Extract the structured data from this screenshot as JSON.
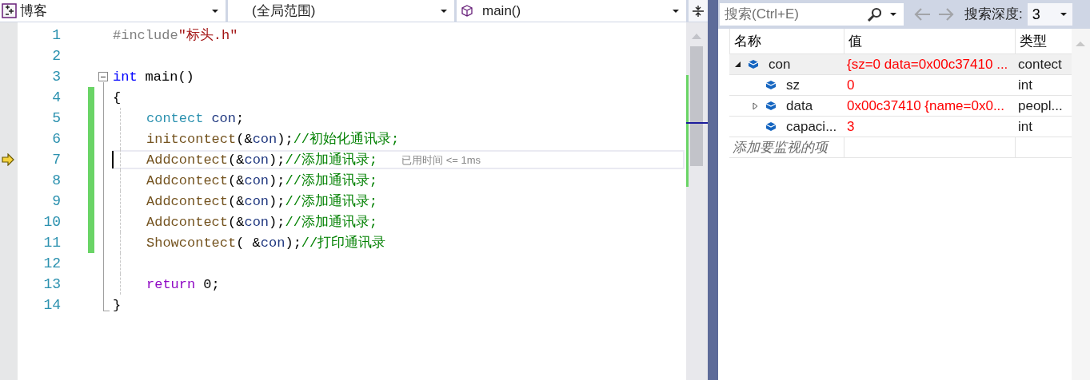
{
  "navbar": {
    "project": "博客",
    "scope": "(全局范围)",
    "member": "main()"
  },
  "editor": {
    "lines": [
      {
        "number": "1",
        "changed": false,
        "current": false,
        "fold": false,
        "indented": false,
        "tokens": [
          {
            "kind": "preproc",
            "text": "#include"
          },
          {
            "kind": "string",
            "text": "\"标头.h\""
          }
        ]
      },
      {
        "number": "2",
        "changed": false,
        "current": false,
        "fold": false,
        "indented": false
      },
      {
        "number": "3",
        "changed": false,
        "current": false,
        "fold": true,
        "indented": false,
        "tokens": [
          {
            "kind": "keyword",
            "text": "int"
          },
          {
            "kind": "plain",
            "text": "main()",
            "spaced": true
          }
        ]
      },
      {
        "number": "4",
        "changed": true,
        "current": false,
        "fold": false,
        "indented": false,
        "tokens": [
          {
            "kind": "plain",
            "text": "{"
          }
        ]
      },
      {
        "number": "5",
        "changed": true,
        "current": false,
        "fold": false,
        "indented": true,
        "tokens": [
          {
            "kind": "type",
            "text": "contect"
          },
          {
            "kind": "variable",
            "text": "con",
            "spaced": true
          },
          {
            "kind": "plain",
            "text": ";"
          }
        ]
      },
      {
        "number": "6",
        "changed": true,
        "current": false,
        "fold": false,
        "indented": true,
        "tokens": [
          {
            "kind": "function",
            "text": "initcontect"
          },
          {
            "kind": "plain",
            "text": "(&"
          },
          {
            "kind": "variable",
            "text": "con"
          },
          {
            "kind": "plain",
            "text": ");"
          },
          {
            "kind": "comment",
            "text": "//初始化通讯录;"
          }
        ]
      },
      {
        "number": "7",
        "changed": true,
        "current": true,
        "hint": "已用时间 <= 1ms",
        "fold": false,
        "indented": true,
        "tokens": [
          {
            "kind": "function",
            "text": "Addcontect"
          },
          {
            "kind": "plain",
            "text": "(&"
          },
          {
            "kind": "variable",
            "text": "con"
          },
          {
            "kind": "plain",
            "text": ");"
          },
          {
            "kind": "comment",
            "text": "//添加通讯录;"
          }
        ]
      },
      {
        "number": "8",
        "changed": true,
        "current": false,
        "fold": false,
        "indented": true,
        "tokens": [
          {
            "kind": "function",
            "text": "Addcontect"
          },
          {
            "kind": "plain",
            "text": "(&"
          },
          {
            "kind": "variable",
            "text": "con"
          },
          {
            "kind": "plain",
            "text": ");"
          },
          {
            "kind": "comment",
            "text": "//添加通讯录;"
          }
        ]
      },
      {
        "number": "9",
        "changed": true,
        "current": false,
        "fold": false,
        "indented": true,
        "tokens": [
          {
            "kind": "function",
            "text": "Addcontect"
          },
          {
            "kind": "plain",
            "text": "(&"
          },
          {
            "kind": "variable",
            "text": "con"
          },
          {
            "kind": "plain",
            "text": ");"
          },
          {
            "kind": "comment",
            "text": "//添加通讯录;"
          }
        ]
      },
      {
        "number": "10",
        "changed": true,
        "current": false,
        "fold": false,
        "indented": true,
        "tokens": [
          {
            "kind": "function",
            "text": "Addcontect"
          },
          {
            "kind": "plain",
            "text": "(&"
          },
          {
            "kind": "variable",
            "text": "con"
          },
          {
            "kind": "plain",
            "text": ");"
          },
          {
            "kind": "comment",
            "text": "//添加通讯录;"
          }
        ]
      },
      {
        "number": "11",
        "changed": true,
        "current": false,
        "fold": false,
        "indented": true,
        "tokens": [
          {
            "kind": "function",
            "text": "Showcontect"
          },
          {
            "kind": "plain",
            "text": "( &"
          },
          {
            "kind": "variable",
            "text": "con"
          },
          {
            "kind": "plain",
            "text": ");"
          },
          {
            "kind": "comment",
            "text": "//打印通讯录"
          }
        ]
      },
      {
        "number": "12",
        "changed": false,
        "current": false,
        "fold": false,
        "indented": true
      },
      {
        "number": "13",
        "changed": false,
        "current": false,
        "fold": false,
        "indented": true,
        "tokens": [
          {
            "kind": "keyword2",
            "text": "return"
          },
          {
            "kind": "plain",
            "text": "0;",
            "spaced": true
          }
        ]
      },
      {
        "number": "14",
        "changed": false,
        "current": false,
        "fold": false,
        "indented": false,
        "tokens": [
          {
            "kind": "plain",
            "text": "}"
          }
        ]
      }
    ]
  },
  "watch": {
    "search": {
      "placeholder": "搜索(Ctrl+E)"
    },
    "depth_label": "搜索深度:",
    "depth": "3",
    "columns": [
      "名称",
      "值",
      "类型"
    ],
    "rows": [
      {
        "name": "con",
        "value": "{sz=0 data=0x00c37410 ...",
        "type": "contect",
        "changed": true,
        "selected": true,
        "expanded": true,
        "children": [
          {
            "name": "sz",
            "value": "0",
            "type": "int",
            "changed": true,
            "selected": false
          },
          {
            "name": "data",
            "value": "0x00c37410 {name=0x0...",
            "type": "peopl...",
            "changed": true,
            "selected": false,
            "expanded": false
          },
          {
            "name": "capaci...",
            "value": "3",
            "type": "int",
            "changed": true,
            "selected": false
          }
        ]
      }
    ],
    "add_placeholder": "添加要监视的项"
  }
}
